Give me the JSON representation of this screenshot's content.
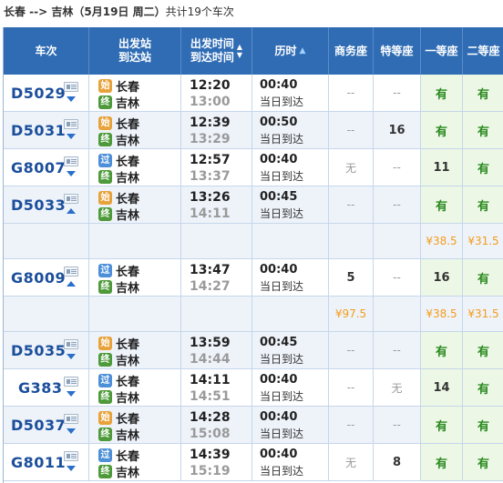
{
  "summary": {
    "route": "长春 --> 吉林",
    "date": "（5月19日  周二）",
    "count": "共计19个车次"
  },
  "header": {
    "train": "车次",
    "station_top": "出发站",
    "station_bottom": "到达站",
    "time_top": "出发时间",
    "time_bottom": "到达时间",
    "sort_up": "▲",
    "sort_down": "▼",
    "duration": "历时",
    "duration_sort": "▲",
    "biz": "商务座",
    "special": "特等座",
    "first": "一等座",
    "second": "二等座"
  },
  "icons": {
    "start_badge": "始",
    "pass_badge": "过",
    "end_badge": "终"
  },
  "rows": [
    {
      "type": "train",
      "no": "D5029",
      "arrow": "down",
      "from": "长春",
      "from_type": "start",
      "to": "吉林",
      "dep": "12:20",
      "arr": "13:00",
      "dur": "00:40",
      "day": "当日到达",
      "biz": "--",
      "spec": "--",
      "first": "有",
      "second": "有"
    },
    {
      "type": "train",
      "no": "D5031",
      "arrow": "down",
      "from": "长春",
      "from_type": "start",
      "to": "吉林",
      "dep": "12:39",
      "arr": "13:29",
      "dur": "00:50",
      "day": "当日到达",
      "biz": "--",
      "spec": "16",
      "first": "有",
      "second": "有"
    },
    {
      "type": "train",
      "no": "G8007",
      "arrow": "down",
      "from": "长春",
      "from_type": "pass",
      "to": "吉林",
      "dep": "12:57",
      "arr": "13:37",
      "dur": "00:40",
      "day": "当日到达",
      "biz": "无",
      "spec": "--",
      "first": "11",
      "second": "有"
    },
    {
      "type": "train",
      "no": "D5033",
      "arrow": "up",
      "from": "长春",
      "from_type": "start",
      "to": "吉林",
      "dep": "13:26",
      "arr": "14:11",
      "dur": "00:45",
      "day": "当日到达",
      "biz": "--",
      "spec": "--",
      "first": "有",
      "second": "有"
    },
    {
      "type": "price",
      "biz": "",
      "spec": "",
      "first": "¥38.5",
      "second": "¥31.5"
    },
    {
      "type": "train",
      "no": "G8009",
      "arrow": "up",
      "from": "长春",
      "from_type": "pass",
      "to": "吉林",
      "dep": "13:47",
      "arr": "14:27",
      "dur": "00:40",
      "day": "当日到达",
      "biz": "5",
      "spec": "--",
      "first": "16",
      "second": "有"
    },
    {
      "type": "price",
      "biz": "¥97.5",
      "spec": "",
      "first": "¥38.5",
      "second": "¥31.5"
    },
    {
      "type": "train",
      "no": "D5035",
      "arrow": "down",
      "from": "长春",
      "from_type": "start",
      "to": "吉林",
      "dep": "13:59",
      "arr": "14:44",
      "dur": "00:45",
      "day": "当日到达",
      "biz": "--",
      "spec": "--",
      "first": "有",
      "second": "有"
    },
    {
      "type": "train",
      "no": "G383",
      "arrow": "down",
      "from": "长春",
      "from_type": "pass",
      "to": "吉林",
      "dep": "14:11",
      "arr": "14:51",
      "dur": "00:40",
      "day": "当日到达",
      "biz": "--",
      "spec": "无",
      "first": "14",
      "second": "有"
    },
    {
      "type": "train",
      "no": "D5037",
      "arrow": "down",
      "from": "长春",
      "from_type": "start",
      "to": "吉林",
      "dep": "14:28",
      "arr": "15:08",
      "dur": "00:40",
      "day": "当日到达",
      "biz": "--",
      "spec": "--",
      "first": "有",
      "second": "有"
    },
    {
      "type": "train",
      "no": "G8011",
      "arrow": "down",
      "from": "长春",
      "from_type": "pass",
      "to": "吉林",
      "dep": "14:39",
      "arr": "15:19",
      "dur": "00:40",
      "day": "当日到达",
      "biz": "无",
      "spec": "8",
      "first": "有",
      "second": "有"
    }
  ]
}
